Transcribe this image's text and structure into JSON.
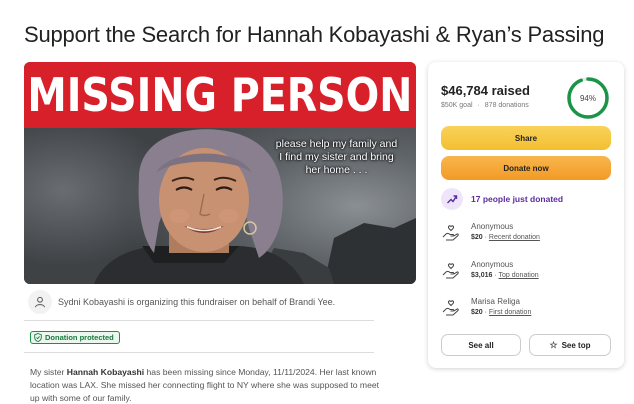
{
  "page": {
    "title": "Support the Search for Hannah Kobayashi & Ryan’s Passing"
  },
  "hero": {
    "banner_text": "MISSING PERSON",
    "overlay_caption": "please help my family and I find my sister and bring her home . . ."
  },
  "organizer": {
    "text": "Sydni Kobayashi is organizing this fundraiser on behalf of Brandi Yee."
  },
  "badge": {
    "protected_label": "Donation protected"
  },
  "story": {
    "lead": "My sister ",
    "name": "Hannah Kobayashi",
    "rest": " has been missing since Monday, 11/11/2024. Her last known location was LAX. She missed her connecting flight to NY where she was supposed to meet up with some of our family."
  },
  "donate_card": {
    "raised": "$46,784 raised",
    "goal": "$50K goal",
    "separator": "·",
    "donation_count": "878 donations",
    "progress_label": "94%",
    "progress_fraction": 0.94,
    "share_label": "Share",
    "donate_label": "Donate now",
    "trend_text": "17 people just donated",
    "donors": [
      {
        "name": "Anonymous",
        "amount": "$20",
        "tag": "Recent donation"
      },
      {
        "name": "Anonymous",
        "amount": "$3,016",
        "tag": "Top donation"
      },
      {
        "name": "Marisa Religa",
        "amount": "$20",
        "tag": "First donation"
      }
    ],
    "see_all_label": "See all",
    "see_top_label": "See top"
  },
  "colors": {
    "banner_red": "#d8202a",
    "progress_green": "#1a9447",
    "share_yellow": "#f5c842",
    "donate_orange": "#f4a332",
    "trend_purple": "#5b2ca0",
    "protected_green": "#1a8f4a"
  },
  "icons": {
    "organizer": "person-icon",
    "protected": "shield-check-icon",
    "trend": "trending-up-icon",
    "donor": "donation-hand-icon",
    "see_top": "star-icon"
  }
}
